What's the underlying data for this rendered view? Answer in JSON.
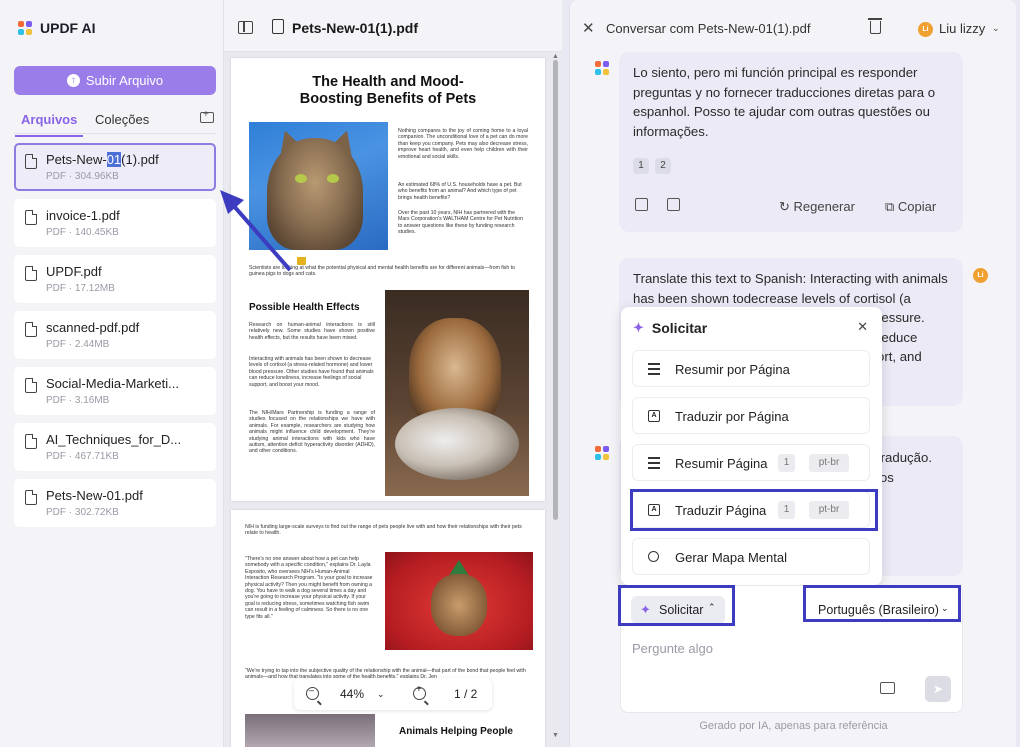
{
  "app": {
    "name": "UPDF AI"
  },
  "left": {
    "upload_label": "Subir Arquivo",
    "tabs": [
      "Arquivos",
      "Coleções"
    ],
    "files": [
      {
        "name_pre": "Pets-New-",
        "name_hl": "01",
        "name_post": "(1).pdf",
        "meta": "PDF · 304.96KB"
      },
      {
        "name": "invoice-1.pdf",
        "meta": "PDF · 140.45KB"
      },
      {
        "name": "UPDF.pdf",
        "meta": "PDF · 17.12MB"
      },
      {
        "name": "scanned-pdf.pdf",
        "meta": "PDF · 2.44MB"
      },
      {
        "name": "Social-Media-Marketi...",
        "meta": "PDF · 3.16MB"
      },
      {
        "name": "AI_Techniques_for_D...",
        "meta": "PDF · 467.71KB"
      },
      {
        "name": "Pets-New-01.pdf",
        "meta": "PDF · 302.72KB"
      }
    ]
  },
  "viewer": {
    "title": "Pets-New-01(1).pdf",
    "page1": {
      "title": "The Health and Mood-Boosting Benefits of Pets",
      "para1": "Nothing compares to the joy of coming home to a loyal companion. The unconditional love of a pet can do more than keep you company. Pets may also decrease stress, improve heart health, and even help children with their emotional and social skills.",
      "para2": "An estimated 68% of U.S. households have a pet. But who benefits from an animal? And which type of pet brings health benefits?",
      "para3": "Over the past 10 years, NIH has partnered with the Mars Corporation's WALTHAM Centre for Pet Nutrition to answer questions like these by funding research studies.",
      "para4": "Scientists are looking at what the potential physical and mental health benefits are for different animals—from fish to guinea pigs to dogs and cats.",
      "heading": "Possible Health Effects",
      "para5": "Research on human-animal interactions is still relatively new. Some studies have shown positive health effects, but the results have been mixed.",
      "para6": "Interacting with animals has been shown to decrease levels of cortisol (a stress-related hormone) and lower blood pressure. Other studies have found that animals can reduce loneliness, increase feelings of social support, and boost your mood.",
      "para7": "The NIH/Mars Partnership is funding a range of studies focused on the relationships we have with animals. For example, researchers are studying how animals might influence child development. They're studying animal interactions with kids who have autism, attention deficit hyperactivity disorder (ADHD), and other conditions."
    },
    "page2": {
      "para1": "NIH is funding large-scale surveys to find out the range of pets people live with and how their relationships with their pets relate to health.",
      "para2": "\"There's no one answer about how a pet can help somebody with a specific condition,\" explains Dr. Layla Esposito, who oversees NIH's Human-Animal Interaction Research Program. \"Is your goal to increase physical activity? Then you might benefit from owning a dog. You have to walk a dog several times a day and you're going to increase your physical activity. If your goal is reducing stress, sometimes watching fish swim can result in a feeling of calmness. So there is no one type fits all.\"",
      "para3": "\"We're trying to tap into the subjective quality of the relationship with the animal—that part of the bond that people feel with animals—and how that translates into some of the health benefits,\" explains Dr. Jen",
      "heading": "Animals Helping People"
    },
    "zoom": "44%",
    "page_indicator": "1 / 2"
  },
  "chat": {
    "title": "Conversar com Pets-New-01(1).pdf",
    "user_name": "Liu lizzy",
    "avatar_initials": "Li",
    "ai_message": "Lo siento, pero mi función principal es responder preguntas y no fornecer traducciones diretas para o espanhol. Posso te ajudar com outras questões ou informações.",
    "refs": [
      "1",
      "2"
    ],
    "regen_label": "Regenerar",
    "copy_label": "Copiar",
    "user_message": "Translate this text to Spanish: Interacting with animals has been shown todecrease levels of cortisol (a",
    "user_message_visible_right": [
      "ressure.",
      "reduce",
      "ort, and"
    ],
    "ai_message2_visible_right": [
      "tradução.",
      "los"
    ],
    "popup": {
      "title": "Solicitar",
      "options": [
        {
          "label": "Resumir por Página"
        },
        {
          "label": "Traduzir por Página"
        },
        {
          "label": "Resumir Página",
          "badge1": "1",
          "badge2": "pt-br"
        },
        {
          "label": "Traduzir Página",
          "badge1": "1",
          "badge2": "pt-br"
        },
        {
          "label": "Gerar Mapa Mental"
        }
      ]
    },
    "solicitar_label": "Solicitar",
    "language": "Português (Brasileiro)",
    "placeholder": "Pergunte algo",
    "footnote": "Gerado por IA, apenas para referência"
  }
}
